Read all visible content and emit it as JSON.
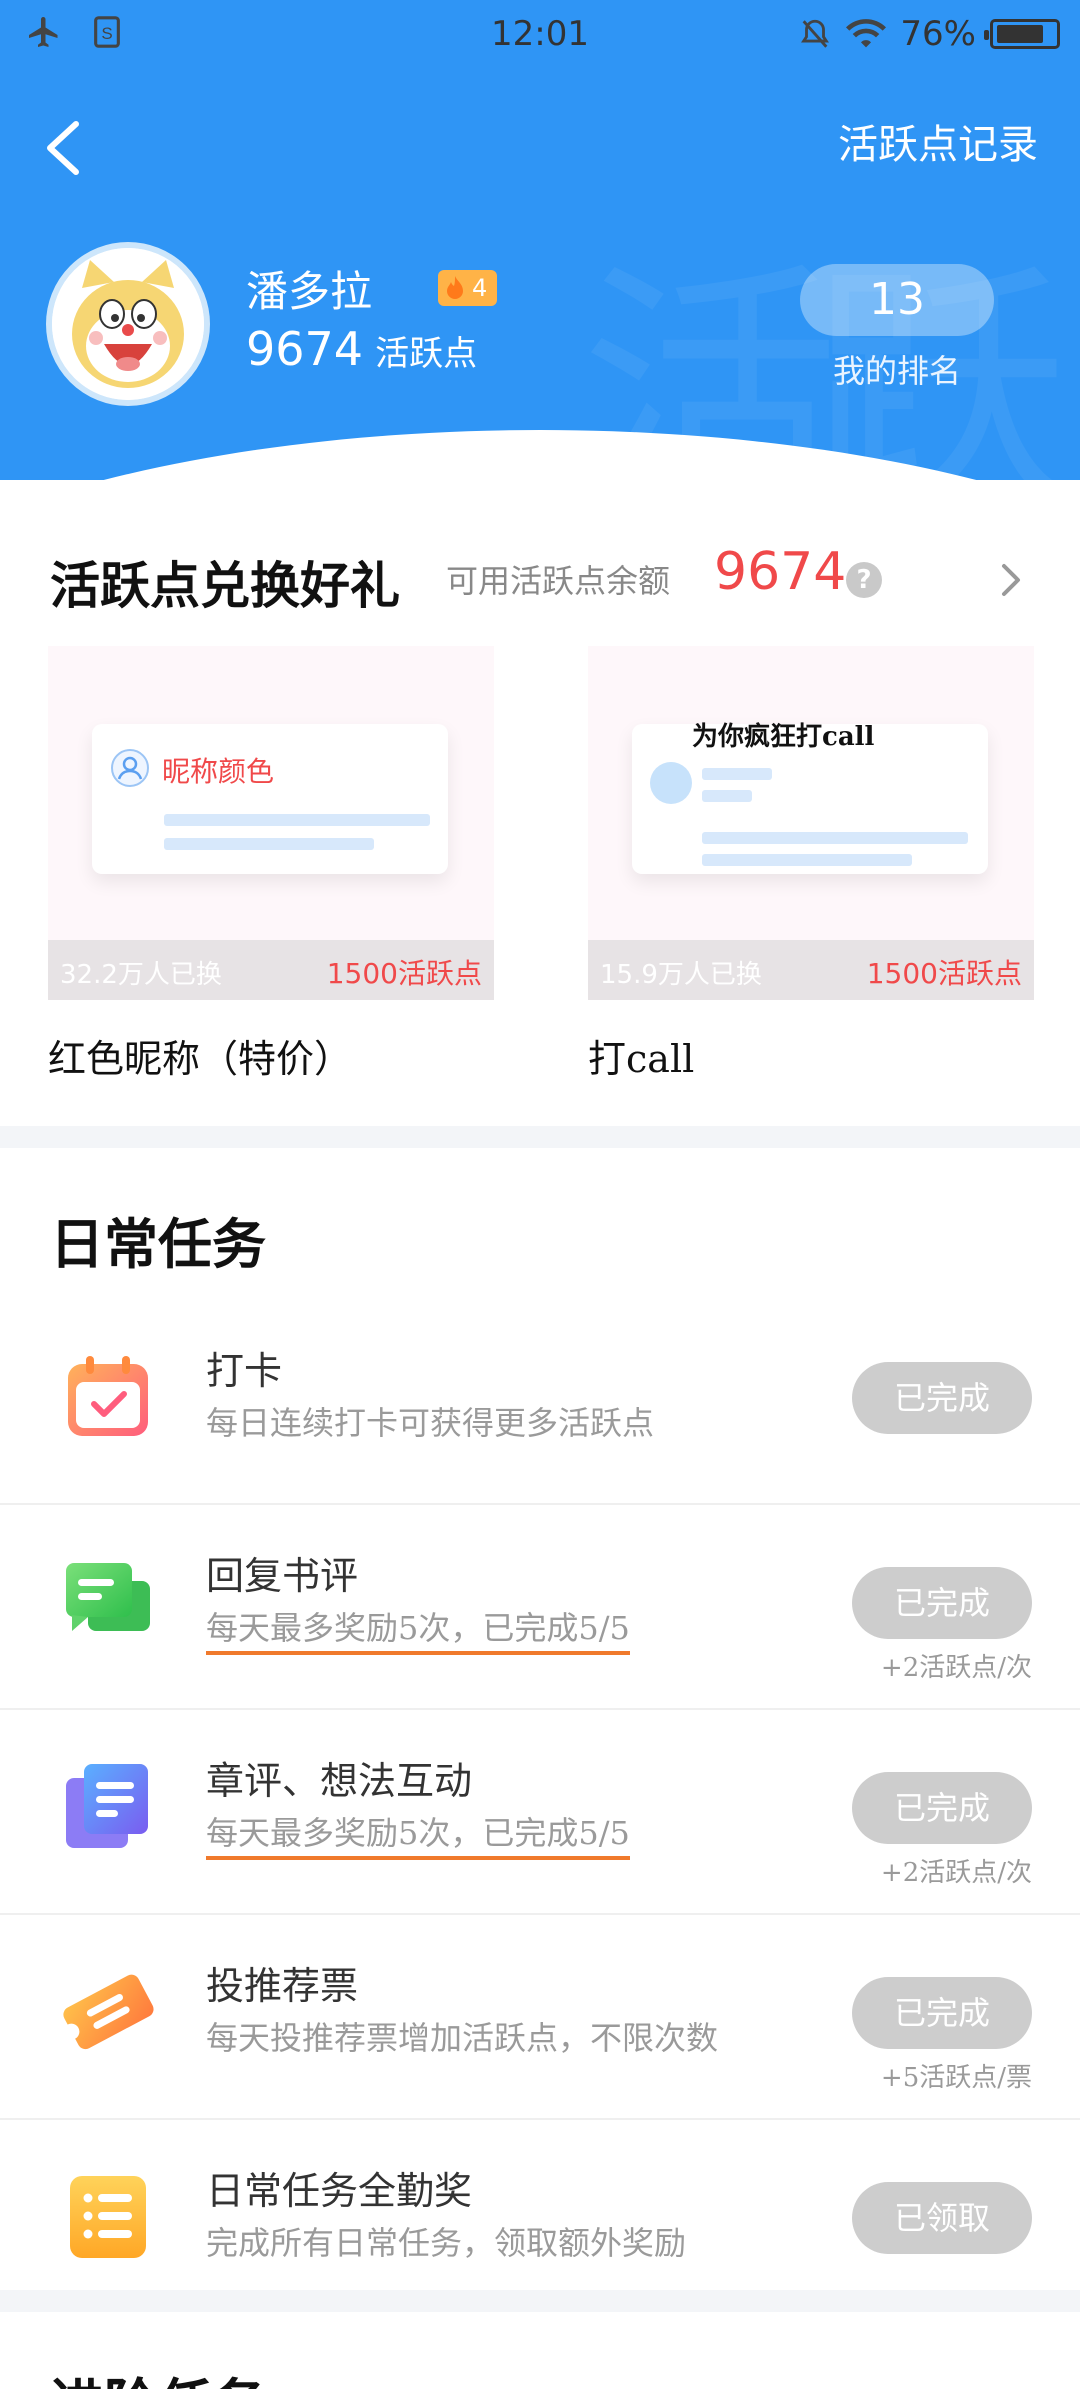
{
  "status_bar": {
    "time": "12:01",
    "battery": "76%",
    "icons": [
      "airplane-icon",
      "sim-icon",
      "mute-icon",
      "wifi-icon",
      "battery-icon"
    ]
  },
  "header": {
    "record_link": "活跃点记录",
    "user": {
      "name": "潘多拉",
      "level": "4",
      "points": "9674",
      "points_unit": "活跃点"
    },
    "rank": {
      "value": "13",
      "label": "我的排名"
    }
  },
  "exchange": {
    "title": "活跃点兑换好礼",
    "balance_label": "可用活跃点余额",
    "balance": "9674",
    "items": [
      {
        "name": "红色昵称（特价）",
        "preview_label": "昵称颜色",
        "exchanged": "32.2万人已换",
        "cost": "1500活跃点"
      },
      {
        "name": "打call",
        "preview_label": "为你疯狂打call",
        "exchanged": "15.9万人已换",
        "cost": "1500活跃点"
      }
    ]
  },
  "daily": {
    "title": "日常任务",
    "tasks": [
      {
        "name": "打卡",
        "desc": "每日连续打卡可获得更多活跃点",
        "status": "已完成",
        "reward": ""
      },
      {
        "name": "回复书评",
        "desc": "每天最多奖励5次，已完成5/5",
        "status": "已完成",
        "reward": "+2活跃点/次"
      },
      {
        "name": "章评、想法互动",
        "desc": "每天最多奖励5次，已完成5/5",
        "status": "已完成",
        "reward": "+2活跃点/次"
      },
      {
        "name": "投推荐票",
        "desc": "每天投推荐票增加活跃点，不限次数",
        "status": "已完成",
        "reward": "+5活跃点/票"
      },
      {
        "name": "日常任务全勤奖",
        "desc": "完成所有日常任务，领取额外奖励",
        "status": "已领取",
        "reward": ""
      }
    ]
  },
  "advanced": {
    "title": "进阶任务"
  },
  "colors": {
    "header_blue": "#2f95f5",
    "accent_red": "#f0494a",
    "button_gray": "#cdcdcd",
    "underline_orange": "#f07a2c"
  }
}
